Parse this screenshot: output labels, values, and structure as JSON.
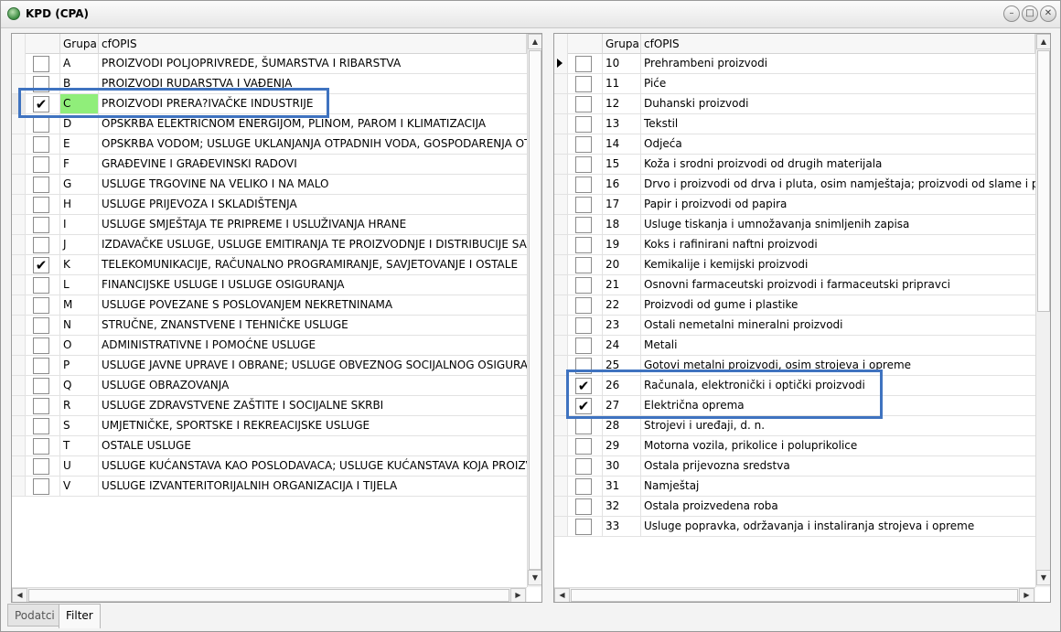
{
  "window": {
    "title": "KPD (CPA)",
    "buttons": [
      "minimize",
      "maximize",
      "close"
    ]
  },
  "left_grid": {
    "columns": [
      "Grupa",
      "cfOPIS"
    ],
    "rows": [
      {
        "grupa": "A",
        "opis": "PROIZVODI POLJOPRIVREDE, ŠUMARSTVA I RIBARSTVA",
        "checked": false
      },
      {
        "grupa": "B",
        "opis": "PROIZVODI RUDARSTVA I VAĐENJA",
        "checked": false
      },
      {
        "grupa": "C",
        "opis": "PROIZVODI PRERA?IVAČKE INDUSTRIJE",
        "checked": true,
        "selected": true
      },
      {
        "grupa": "D",
        "opis": "OPSKRBA ELEKTRIČNOM ENERGIJOM, PLINOM, PAROM I KLIMATIZACIJA",
        "checked": false
      },
      {
        "grupa": "E",
        "opis": "OPSKRBA VODOM; USLUGE UKLANJANJA OTPADNIH VODA, GOSPODARENJA OTPADOM",
        "checked": false
      },
      {
        "grupa": "F",
        "opis": "GRAĐEVINE I GRAĐEVINSKI RADOVI",
        "checked": false
      },
      {
        "grupa": "G",
        "opis": "USLUGE TRGOVINE NA VELIKO I NA MALO",
        "checked": false
      },
      {
        "grupa": "H",
        "opis": "USLUGE PRIJEVOZA I SKLADIŠTENJA",
        "checked": false
      },
      {
        "grupa": "I",
        "opis": "USLUGE SMJEŠTAJA TE PRIPREME I USLUŽIVANJA HRANE",
        "checked": false
      },
      {
        "grupa": "J",
        "opis": "IZDAVAČKE USLUGE, USLUGE EMITIRANJA TE PROIZVODNJE I DISTRIBUCIJE SADRŽAJA",
        "checked": false
      },
      {
        "grupa": "K",
        "opis": "TELEKOMUNIKACIJE, RAČUNALNO PROGRAMIRANJE, SAVJETOVANJE I OSTALE",
        "checked": true
      },
      {
        "grupa": "L",
        "opis": "FINANCIJSKE USLUGE I USLUGE OSIGURANJA",
        "checked": false
      },
      {
        "grupa": "M",
        "opis": "USLUGE POVEZANE S POSLOVANJEM NEKRETNINAMA",
        "checked": false
      },
      {
        "grupa": "N",
        "opis": "STRUČNE, ZNANSTVENE I TEHNIČKE USLUGE",
        "checked": false
      },
      {
        "grupa": "O",
        "opis": "ADMINISTRATIVNE I POMOĆNE USLUGE",
        "checked": false
      },
      {
        "grupa": "P",
        "opis": "USLUGE JAVNE UPRAVE I OBRANE; USLUGE OBVEZNOG SOCIJALNOG OSIGURANJA",
        "checked": false
      },
      {
        "grupa": "Q",
        "opis": "USLUGE OBRAZOVANJA",
        "checked": false
      },
      {
        "grupa": "R",
        "opis": "USLUGE ZDRAVSTVENE ZAŠTITE I SOCIJALNE SKRBI",
        "checked": false
      },
      {
        "grupa": "S",
        "opis": "UMJETNIČKE, SPORTSKE I REKREACIJSKE USLUGE",
        "checked": false
      },
      {
        "grupa": "T",
        "opis": "OSTALE USLUGE",
        "checked": false
      },
      {
        "grupa": "U",
        "opis": "USLUGE KUĆANSTAVA KAO POSLODAVACA; USLUGE KUĆANSTAVA KOJA PROIZVODE",
        "checked": false
      },
      {
        "grupa": "V",
        "opis": "USLUGE IZVANTERITORIJALNIH ORGANIZACIJA I TIJELA",
        "checked": false
      }
    ]
  },
  "right_grid": {
    "columns": [
      "Grupa",
      "cfOPIS"
    ],
    "rows": [
      {
        "grupa": "10",
        "opis": "Prehrambeni proizvodi",
        "checked": false,
        "current": true
      },
      {
        "grupa": "11",
        "opis": "Piće",
        "checked": false
      },
      {
        "grupa": "12",
        "opis": "Duhanski proizvodi",
        "checked": false
      },
      {
        "grupa": "13",
        "opis": "Tekstil",
        "checked": false
      },
      {
        "grupa": "14",
        "opis": "Odjeća",
        "checked": false
      },
      {
        "grupa": "15",
        "opis": "Koža i srodni proizvodi od drugih materijala",
        "checked": false
      },
      {
        "grupa": "16",
        "opis": "Drvo i proizvodi od drva i pluta, osim namještaja; proizvodi od slame i pletarskih materijala",
        "checked": false
      },
      {
        "grupa": "17",
        "opis": "Papir i proizvodi od papira",
        "checked": false
      },
      {
        "grupa": "18",
        "opis": "Usluge tiskanja i umnožavanja snimljenih zapisa",
        "checked": false
      },
      {
        "grupa": "19",
        "opis": "Koks i rafinirani naftni proizvodi",
        "checked": false
      },
      {
        "grupa": "20",
        "opis": "Kemikalije i kemijski proizvodi",
        "checked": false
      },
      {
        "grupa": "21",
        "opis": "Osnovni farmaceutski proizvodi i farmaceutski pripravci",
        "checked": false
      },
      {
        "grupa": "22",
        "opis": "Proizvodi od gume i plastike",
        "checked": false
      },
      {
        "grupa": "23",
        "opis": "Ostali nemetalni mineralni proizvodi",
        "checked": false
      },
      {
        "grupa": "24",
        "opis": "Metali",
        "checked": false
      },
      {
        "grupa": "25",
        "opis": "Gotovi metalni proizvodi, osim strojeva i opreme",
        "checked": false
      },
      {
        "grupa": "26",
        "opis": "Računala, elektronički i optički proizvodi",
        "checked": true
      },
      {
        "grupa": "27",
        "opis": "Električna oprema",
        "checked": true
      },
      {
        "grupa": "28",
        "opis": "Strojevi i uređaji, d. n.",
        "checked": false
      },
      {
        "grupa": "29",
        "opis": "Motorna vozila, prikolice i poluprikolice",
        "checked": false
      },
      {
        "grupa": "30",
        "opis": "Ostala prijevozna sredstva",
        "checked": false
      },
      {
        "grupa": "31",
        "opis": "Namještaj",
        "checked": false
      },
      {
        "grupa": "32",
        "opis": "Ostala proizvedena roba",
        "checked": false
      },
      {
        "grupa": "33",
        "opis": "Usluge popravka, održavanja i instaliranja strojeva i opreme",
        "checked": false
      }
    ]
  },
  "tabs": [
    {
      "label": "Podatci",
      "active": false
    },
    {
      "label": "Filter",
      "active": true
    }
  ],
  "colors": {
    "highlight": "#3f73c0",
    "selected_cell": "#90ee7a"
  }
}
